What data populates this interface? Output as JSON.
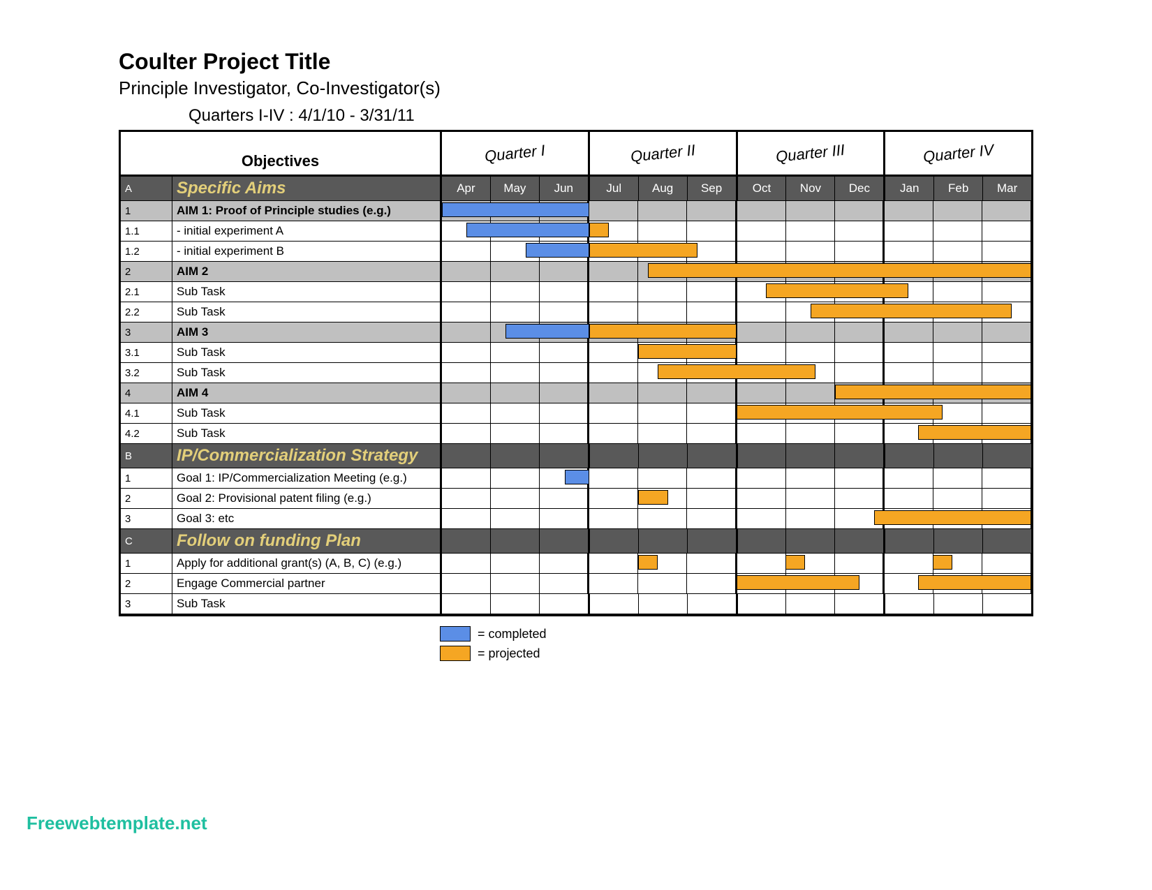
{
  "header": {
    "title": "Coulter Project Title",
    "subtitle": "Principle Investigator, Co-Investigator(s)",
    "quarters_line": "Quarters I-IV : 4/1/10 - 3/31/11",
    "objectives_label": "Objectives"
  },
  "quarters": [
    "Quarter I",
    "Quarter II",
    "Quarter III",
    "Quarter IV"
  ],
  "months": [
    "Apr",
    "May",
    "Jun",
    "Jul",
    "Aug",
    "Sep",
    "Oct",
    "Nov",
    "Dec",
    "Jan",
    "Feb",
    "Mar"
  ],
  "legend": {
    "completed": "= completed",
    "projected": "= projected"
  },
  "colors": {
    "completed": "#5b8ee6",
    "projected": "#f5a623",
    "section_bg": "#595959",
    "section_text": "#e3cf7a",
    "aim_bg": "#c0c0c0"
  },
  "watermark": "Freewebtemplate.net",
  "chart_data": {
    "type": "gantt",
    "x_unit": "month",
    "months": [
      "Apr",
      "May",
      "Jun",
      "Jul",
      "Aug",
      "Sep",
      "Oct",
      "Nov",
      "Dec",
      "Jan",
      "Feb",
      "Mar"
    ],
    "sections": [
      {
        "id": "A",
        "title": "Specific Aims",
        "rows": [
          {
            "id": "1",
            "label": "AIM 1: Proof of Principle studies (e.g.)",
            "type": "aim",
            "bars": [
              {
                "status": "completed",
                "start": 0.0,
                "end": 3.0
              }
            ]
          },
          {
            "id": "1.1",
            "label": " - initial experiment A",
            "type": "task",
            "bars": [
              {
                "status": "completed",
                "start": 0.5,
                "end": 3.0
              },
              {
                "status": "projected",
                "start": 3.0,
                "end": 3.4
              }
            ]
          },
          {
            "id": "1.2",
            "label": " - initial experiment B",
            "type": "task",
            "bars": [
              {
                "status": "completed",
                "start": 1.7,
                "end": 3.0
              },
              {
                "status": "projected",
                "start": 3.0,
                "end": 5.2
              }
            ]
          },
          {
            "id": "2",
            "label": "AIM 2",
            "type": "aim",
            "bars": [
              {
                "status": "projected",
                "start": 4.2,
                "end": 12.0
              }
            ]
          },
          {
            "id": "2.1",
            "label": "Sub Task",
            "type": "task",
            "bars": [
              {
                "status": "projected",
                "start": 6.6,
                "end": 9.5
              }
            ]
          },
          {
            "id": "2.2",
            "label": "Sub Task",
            "type": "task",
            "bars": [
              {
                "status": "projected",
                "start": 7.5,
                "end": 11.6
              }
            ]
          },
          {
            "id": "3",
            "label": "AIM 3",
            "type": "aim",
            "bars": [
              {
                "status": "completed",
                "start": 1.3,
                "end": 3.0
              },
              {
                "status": "projected",
                "start": 3.0,
                "end": 6.0
              }
            ]
          },
          {
            "id": "3.1",
            "label": "Sub Task",
            "type": "task",
            "bars": [
              {
                "status": "projected",
                "start": 4.0,
                "end": 6.0
              }
            ]
          },
          {
            "id": "3.2",
            "label": "Sub Task",
            "type": "task",
            "bars": [
              {
                "status": "projected",
                "start": 4.4,
                "end": 7.6
              }
            ]
          },
          {
            "id": "4",
            "label": "AIM 4",
            "type": "aim",
            "bars": [
              {
                "status": "projected",
                "start": 8.0,
                "end": 12.0
              }
            ]
          },
          {
            "id": "4.1",
            "label": "Sub Task",
            "type": "task",
            "bars": [
              {
                "status": "projected",
                "start": 6.0,
                "end": 10.2
              }
            ]
          },
          {
            "id": "4.2",
            "label": "Sub Task",
            "type": "task",
            "bars": [
              {
                "status": "projected",
                "start": 9.7,
                "end": 12.0
              }
            ]
          }
        ]
      },
      {
        "id": "B",
        "title": "IP/Commercialization Strategy",
        "rows": [
          {
            "id": "1",
            "label": "Goal 1: IP/Commercialization Meeting (e.g.)",
            "type": "task",
            "bars": [
              {
                "status": "completed",
                "start": 2.5,
                "end": 3.0
              }
            ]
          },
          {
            "id": "2",
            "label": "Goal 2: Provisional patent filing (e.g.)",
            "type": "task",
            "bars": [
              {
                "status": "projected",
                "start": 4.0,
                "end": 4.6
              }
            ]
          },
          {
            "id": "3",
            "label": "Goal 3: etc",
            "type": "task",
            "bars": [
              {
                "status": "projected",
                "start": 8.8,
                "end": 12.0
              }
            ]
          }
        ]
      },
      {
        "id": "C",
        "title": "Follow on funding Plan",
        "rows": [
          {
            "id": "1",
            "label": "Apply for additional grant(s) (A, B, C) (e.g.)",
            "type": "task",
            "bars": [
              {
                "status": "projected",
                "start": 4.0,
                "end": 4.4
              },
              {
                "status": "projected",
                "start": 7.0,
                "end": 7.4
              },
              {
                "status": "projected",
                "start": 10.0,
                "end": 10.4
              }
            ]
          },
          {
            "id": "2",
            "label": "Engage Commercial partner",
            "type": "task",
            "bars": [
              {
                "status": "projected",
                "start": 6.0,
                "end": 8.5
              },
              {
                "status": "projected",
                "start": 9.7,
                "end": 12.0
              }
            ]
          },
          {
            "id": "3",
            "label": "Sub Task",
            "type": "task",
            "bars": []
          }
        ]
      }
    ]
  }
}
